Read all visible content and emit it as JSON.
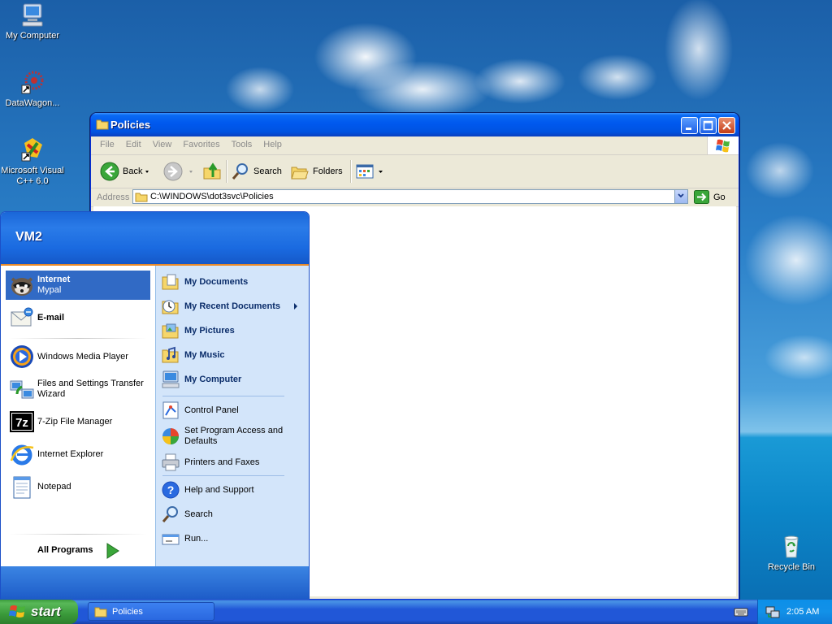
{
  "desktop": {
    "icons": [
      {
        "label": "My Computer",
        "icon": "my-computer-icon"
      },
      {
        "label": "DataWagon...",
        "icon": "datawagon-icon"
      },
      {
        "label": "Microsoft Visual C++ 6.0",
        "icon": "visual-cpp-icon"
      },
      {
        "label": "Recycle Bin",
        "icon": "recycle-bin-icon"
      }
    ]
  },
  "window": {
    "title": "Policies",
    "menu": [
      "File",
      "Edit",
      "View",
      "Favorites",
      "Tools",
      "Help"
    ],
    "toolbar": {
      "back_label": "Back",
      "search_label": "Search",
      "folders_label": "Folders"
    },
    "address": {
      "label": "Address",
      "value": "C:\\WINDOWS\\dot3svc\\Policies",
      "go_label": "Go"
    }
  },
  "start_menu": {
    "user": "VM2",
    "pinned": [
      {
        "title": "Internet",
        "subtitle": "Mypal",
        "icon": "mypal-icon"
      },
      {
        "title": "E-mail",
        "icon": "email-icon"
      }
    ],
    "recent": [
      {
        "label": "Windows Media Player",
        "icon": "media-player-icon"
      },
      {
        "label": "Files and Settings Transfer Wizard",
        "icon": "transfer-wizard-icon"
      },
      {
        "label": "7-Zip File Manager",
        "icon": "7zip-icon"
      },
      {
        "label": "Internet Explorer",
        "icon": "internet-explorer-icon"
      },
      {
        "label": "Notepad",
        "icon": "notepad-icon"
      }
    ],
    "all_programs": "All Programs",
    "right": {
      "my_documents": "My Documents",
      "my_recent_documents": "My Recent Documents",
      "my_pictures": "My Pictures",
      "my_music": "My Music",
      "my_computer": "My Computer",
      "control_panel": "Control Panel",
      "set_program_access": "Set Program Access and Defaults",
      "printers_and_faxes": "Printers and Faxes",
      "help_and_support": "Help and Support",
      "search": "Search",
      "run": "Run..."
    }
  },
  "taskbar": {
    "start_label": "start",
    "task_label": "Policies",
    "clock": "2:05 AM"
  },
  "colors": {
    "titlebar": "#0058ee",
    "start_button": "#3a9a3a",
    "selection": "#316ac5",
    "start_menu_right": "#d3e5fa",
    "taskbar": "#2157d7"
  }
}
